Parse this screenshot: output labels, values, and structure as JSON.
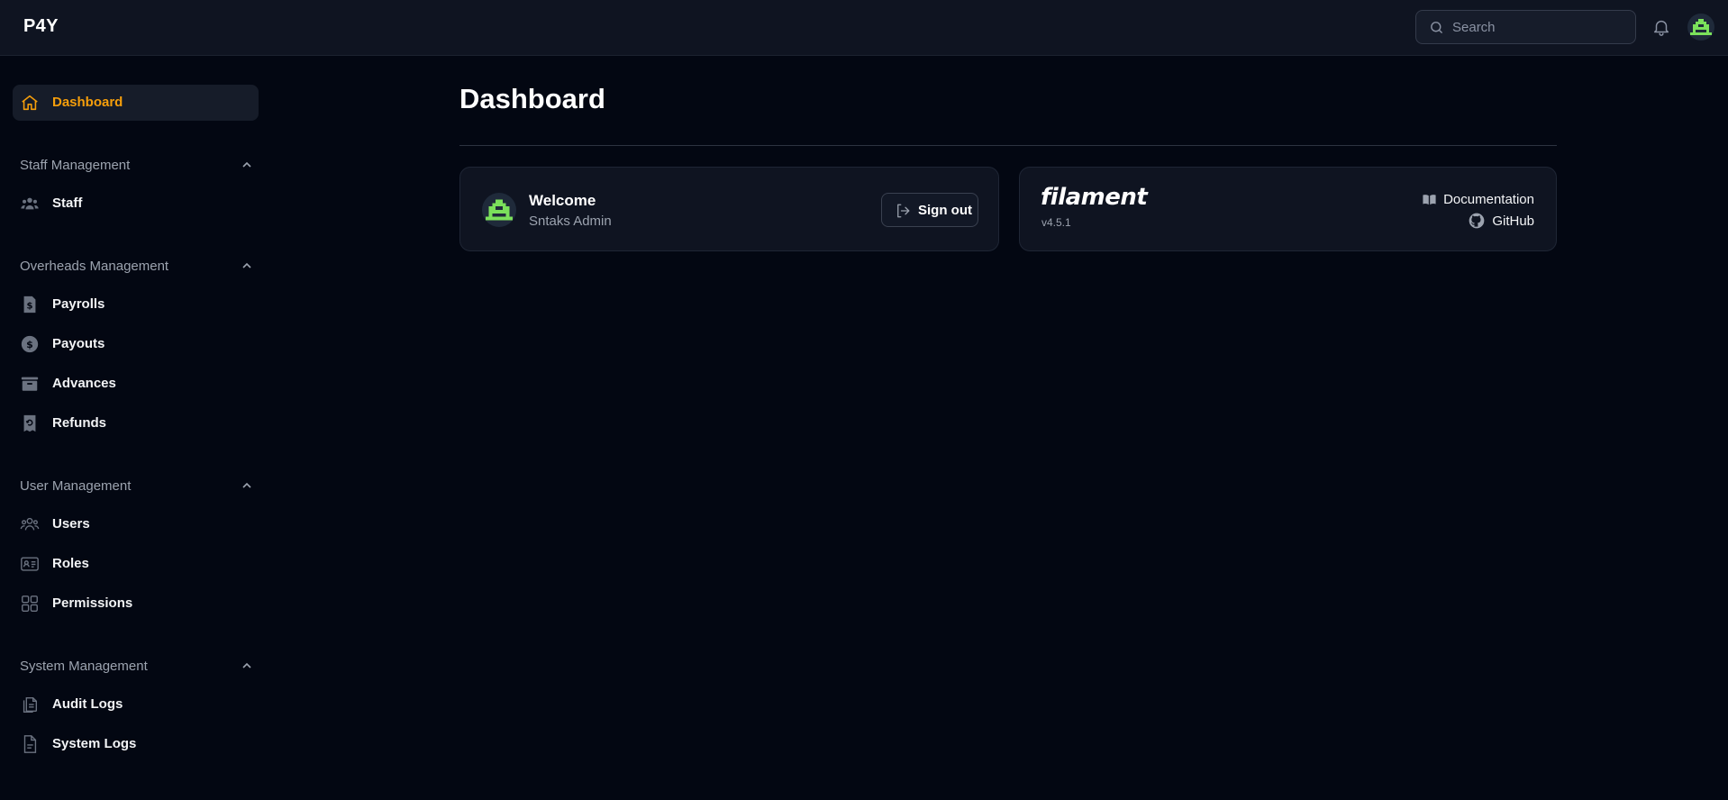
{
  "header": {
    "brand": "P4Y",
    "search": {
      "placeholder": "Search"
    },
    "icons": [
      "search-icon",
      "bell-icon",
      "user-avatar"
    ]
  },
  "sidebar": {
    "dashboard": {
      "label": "Dashboard",
      "icon": "home-icon",
      "active": true
    },
    "groups": [
      {
        "label": "Staff Management",
        "items": [
          {
            "label": "Staff",
            "icon": "users-group-icon"
          }
        ]
      },
      {
        "label": "Overheads Management",
        "items": [
          {
            "label": "Payrolls",
            "icon": "receipt-dollar-icon"
          },
          {
            "label": "Payouts",
            "icon": "dollar-circle-icon"
          },
          {
            "label": "Advances",
            "icon": "archive-box-icon"
          },
          {
            "label": "Refunds",
            "icon": "receipt-refund-icon"
          }
        ]
      },
      {
        "label": "User Management",
        "items": [
          {
            "label": "Users",
            "icon": "users-icon"
          },
          {
            "label": "Roles",
            "icon": "id-card-icon"
          },
          {
            "label": "Permissions",
            "icon": "squares-icon"
          }
        ]
      },
      {
        "label": "System Management",
        "items": [
          {
            "label": "Audit Logs",
            "icon": "documents-icon"
          },
          {
            "label": "System Logs",
            "icon": "document-text-icon"
          }
        ]
      }
    ]
  },
  "main": {
    "title": "Dashboard",
    "welcome": {
      "title": "Welcome",
      "name": "Sntaks Admin",
      "sign_out": "Sign out"
    },
    "filament": {
      "logo": "filament",
      "version": "v4.5.1",
      "documentation": "Documentation",
      "github": "GitHub"
    }
  },
  "colors": {
    "background": "#030712",
    "topbar": "#0f1421",
    "card": "#0f1421",
    "accent": "#f59e0b",
    "avatar_green": "#7be05b",
    "muted_text": "#9ca3af"
  }
}
